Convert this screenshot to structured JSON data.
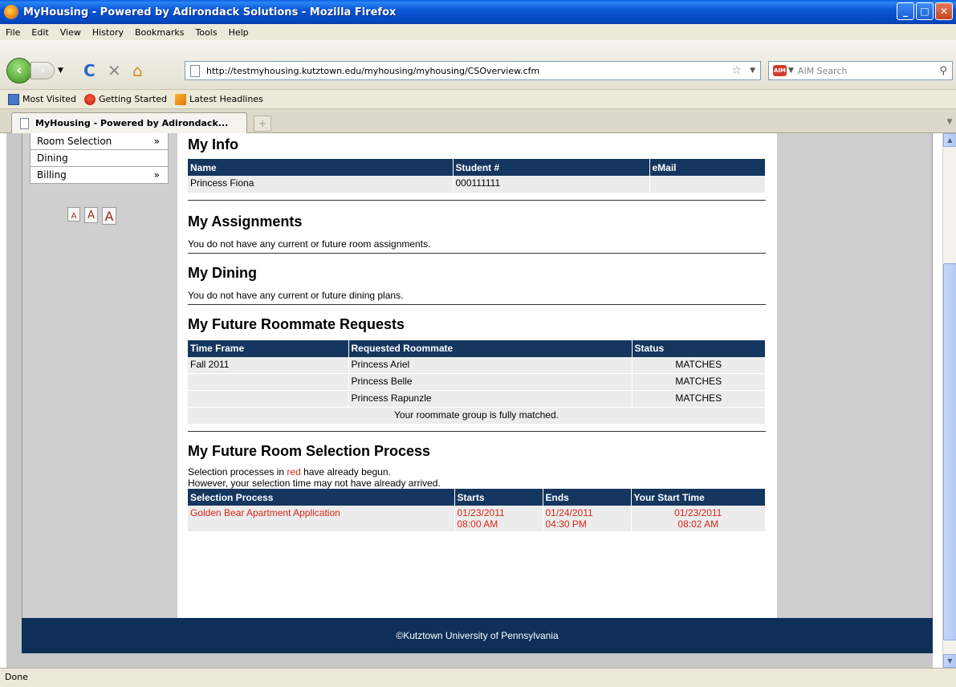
{
  "window": {
    "title": "MyHousing - Powered by Adirondack Solutions - Mozilla Firefox"
  },
  "menu": [
    "File",
    "Edit",
    "View",
    "History",
    "Bookmarks",
    "Tools",
    "Help"
  ],
  "nav": {
    "url": "http://testmyhousing.kutztown.edu/myhousing/myhousing/CSOverview.cfm",
    "search_placeholder": "AIM Search",
    "search_engine_badge": "AIM"
  },
  "bookmarks": [
    "Most Visited",
    "Getting Started",
    "Latest Headlines"
  ],
  "tab": {
    "label": "MyHousing - Powered by Adirondack..."
  },
  "sidebar": {
    "items": [
      {
        "label": "Room Selection",
        "arrow": "»"
      },
      {
        "label": "Dining",
        "arrow": ""
      },
      {
        "label": "Billing",
        "arrow": "»"
      }
    ],
    "font_sizes": [
      "A",
      "A",
      "A"
    ]
  },
  "my_info": {
    "heading": "My Info",
    "columns": [
      "Name",
      "Student #",
      "eMail"
    ],
    "row": [
      "Princess Fiona",
      "000111111",
      ""
    ]
  },
  "assignments": {
    "heading": "My Assignments",
    "message": "You do not have any current or future room assignments."
  },
  "dining": {
    "heading": "My Dining",
    "message": "You do not have any current or future dining plans."
  },
  "roommates": {
    "heading": "My Future Roommate Requests",
    "columns": [
      "Time Frame",
      "Requested Roommate",
      "Status"
    ],
    "rows": [
      [
        "Fall 2011",
        "Princess Ariel",
        "MATCHES"
      ],
      [
        "",
        "Princess Belle",
        "MATCHES"
      ],
      [
        "",
        "Princess Rapunzle",
        "MATCHES"
      ]
    ],
    "summary": "Your roommate group is fully matched."
  },
  "selection": {
    "heading": "My Future Room Selection Process",
    "note_pre": "Selection processes in ",
    "note_red": "red",
    "note_post": " have already begun.",
    "note_line2": "However, your selection time may not have already arrived.",
    "columns": [
      "Selection Process",
      "Starts",
      "Ends",
      "Your Start Time"
    ],
    "row": {
      "process": "Golden Bear Apartment Application",
      "starts_date": "01/23/2011",
      "starts_time": "08:00 AM",
      "ends_date": "01/24/2011",
      "ends_time": "04:30 PM",
      "your_date": "01/23/2011",
      "your_time": "08:02 AM"
    }
  },
  "footer": "©Kutztown University of Pennsylvania",
  "status": "Done",
  "colors": {
    "header": "#14365f",
    "footer": "#0e2f57",
    "alert": "#d8261a"
  }
}
